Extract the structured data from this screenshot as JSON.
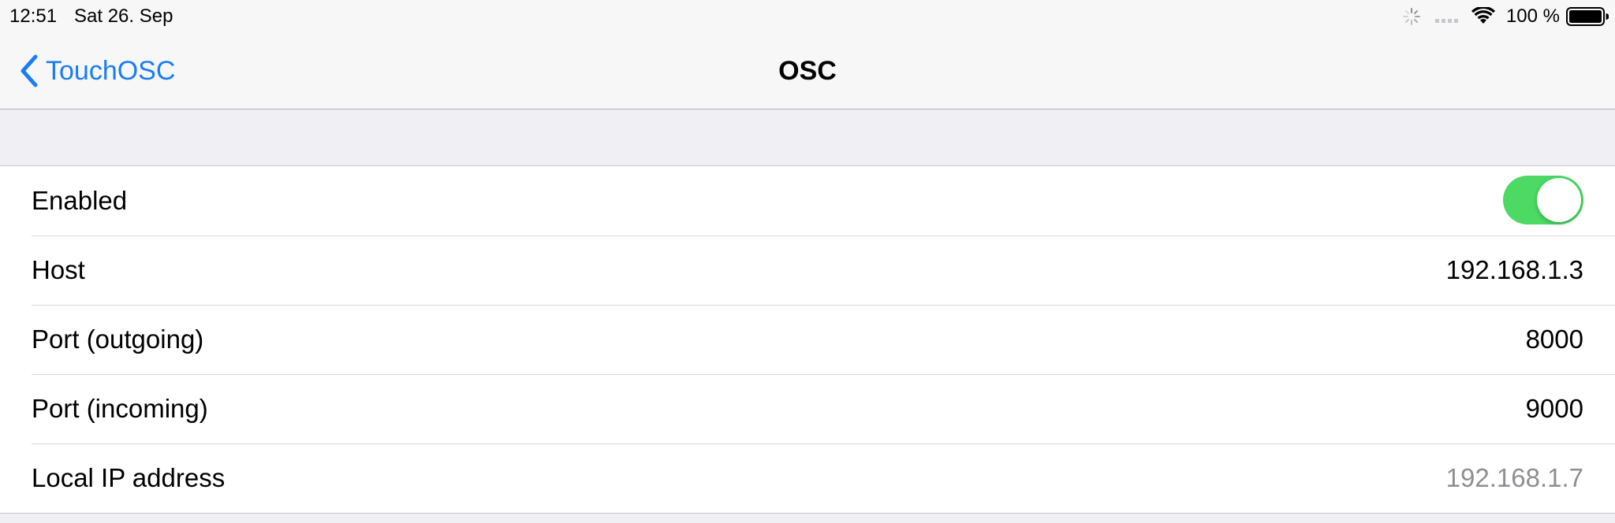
{
  "status_bar": {
    "time": "12:51",
    "date": "Sat 26. Sep",
    "battery_percent": "100 %",
    "battery_level": 1.0,
    "icons": [
      "activity-spinner-icon",
      "cellular-signal-icon",
      "wifi-icon",
      "battery-icon"
    ]
  },
  "nav": {
    "back_label": "TouchOSC",
    "title": "OSC",
    "accent_color": "#1a7cf5"
  },
  "settings": {
    "enabled": {
      "label": "Enabled",
      "value": true,
      "toggle_color": "#4cd964"
    },
    "host": {
      "label": "Host",
      "value": "192.168.1.3"
    },
    "port_outgoing": {
      "label": "Port (outgoing)",
      "value": "8000"
    },
    "port_incoming": {
      "label": "Port (incoming)",
      "value": "9000"
    },
    "local_ip": {
      "label": "Local IP address",
      "value": "192.168.1.7"
    }
  }
}
